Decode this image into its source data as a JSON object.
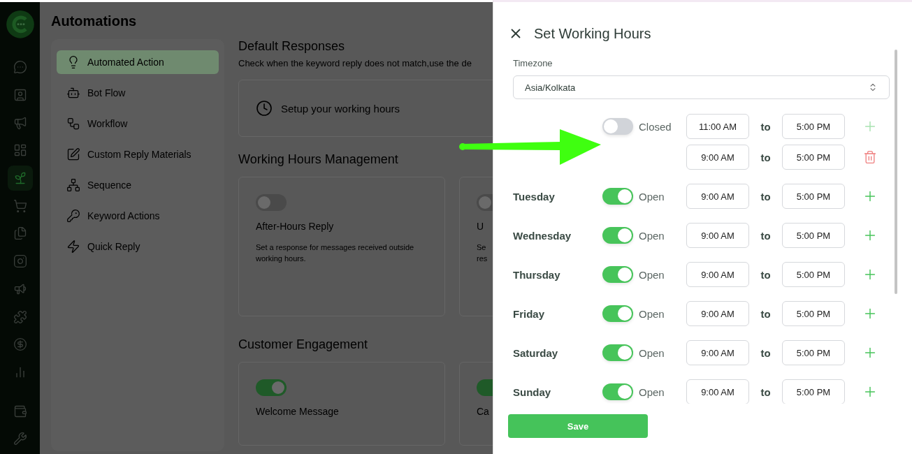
{
  "rail": {
    "items": [
      {
        "selected": false
      },
      {
        "selected": false
      },
      {
        "selected": false
      },
      {
        "selected": false
      },
      {
        "selected": true
      },
      {
        "selected": false
      },
      {
        "selected": false
      },
      {
        "selected": false
      },
      {
        "selected": false
      },
      {
        "selected": false
      },
      {
        "selected": false
      },
      {
        "selected": false
      },
      {
        "selected": false
      },
      {
        "selected": false
      }
    ]
  },
  "page_title": "Automations",
  "menu": [
    {
      "label": "Automated Action",
      "selected": true
    },
    {
      "label": "Bot Flow",
      "selected": false
    },
    {
      "label": "Workflow",
      "selected": false
    },
    {
      "label": "Custom Reply Materials",
      "selected": false
    },
    {
      "label": "Sequence",
      "selected": false
    },
    {
      "label": "Keyword Actions",
      "selected": false
    },
    {
      "label": "Quick Reply",
      "selected": false
    }
  ],
  "default_responses": {
    "title": "Default Responses",
    "subtitle": "Check when the keyword reply does not match,use the de",
    "setup_card": "Setup your working hours"
  },
  "sections": [
    {
      "title": "Working Hours Management",
      "cards": [
        {
          "title": "After-Hours Reply",
          "description_lines": [
            "Set a response for messages received outside",
            "working hours."
          ],
          "on": false
        },
        {
          "title": "U",
          "description_lines": [
            "Se",
            "res"
          ],
          "on": false
        }
      ]
    },
    {
      "title": "Customer Engagement",
      "cards": [
        {
          "title": "Welcome Message",
          "on": true
        },
        {
          "title": "Ca",
          "on": true
        }
      ]
    }
  ],
  "drawer": {
    "title": "Set Working Hours",
    "timezone_label": "Timezone",
    "timezone": "Asia/Kolkata",
    "days": [
      {
        "open": false,
        "status": "Closed",
        "slots": [
          {
            "from": "11:00 AM",
            "sep": "to",
            "to": "5:00 PM",
            "kind": "add"
          },
          {
            "from": "9:00 AM",
            "sep": "to",
            "to": "5:00 PM",
            "kind": "delete"
          }
        ]
      },
      {
        "day": "Tuesday",
        "open": true,
        "status": "Open",
        "slots": [
          {
            "from": "9:00 AM",
            "sep": "to",
            "to": "5:00 PM",
            "kind": "add"
          }
        ]
      },
      {
        "day": "Wednesday",
        "open": true,
        "status": "Open",
        "slots": [
          {
            "from": "9:00 AM",
            "sep": "to",
            "to": "5:00 PM",
            "kind": "add"
          }
        ]
      },
      {
        "day": "Thursday",
        "open": true,
        "status": "Open",
        "slots": [
          {
            "from": "9:00 AM",
            "sep": "to",
            "to": "5:00 PM",
            "kind": "add"
          }
        ]
      },
      {
        "day": "Friday",
        "open": true,
        "status": "Open",
        "slots": [
          {
            "from": "9:00 AM",
            "sep": "to",
            "to": "5:00 PM",
            "kind": "add"
          }
        ]
      },
      {
        "day": "Saturday",
        "open": true,
        "status": "Open",
        "slots": [
          {
            "from": "9:00 AM",
            "sep": "to",
            "to": "5:00 PM",
            "kind": "add"
          }
        ]
      },
      {
        "day": "Sunday",
        "open": true,
        "status": "Open",
        "slots": [
          {
            "from": "9:00 AM",
            "sep": "to",
            "to": "5:00 PM",
            "kind": "add"
          }
        ]
      }
    ],
    "save": "Save"
  }
}
